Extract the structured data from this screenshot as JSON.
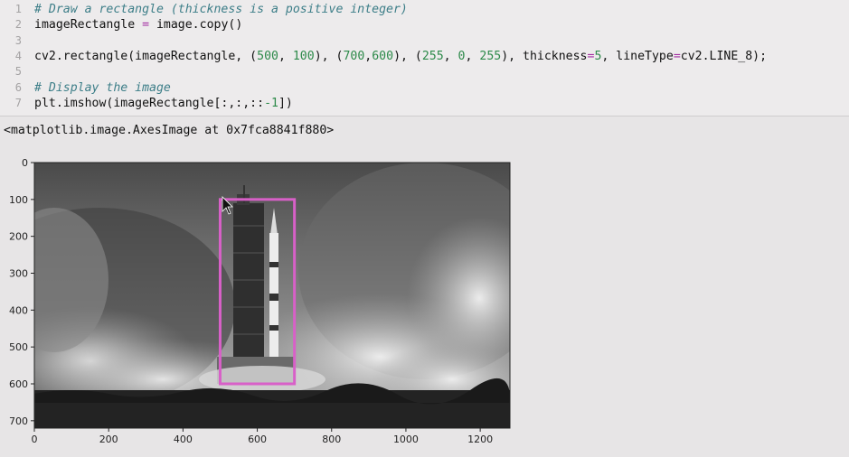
{
  "code_cell": {
    "lines": [
      {
        "n": "1",
        "parts": [
          {
            "t": "# Draw a rectangle (thickness is a positive integer)",
            "c": "cm"
          }
        ]
      },
      {
        "n": "2",
        "parts": [
          {
            "t": "imageRectangle ",
            "c": ""
          },
          {
            "t": "=",
            "c": "op"
          },
          {
            "t": " image.copy()",
            "c": ""
          }
        ]
      },
      {
        "n": "3",
        "parts": []
      },
      {
        "n": "4",
        "parts": [
          {
            "t": "cv2.rectangle(imageRectangle, (",
            "c": ""
          },
          {
            "t": "500",
            "c": "num"
          },
          {
            "t": ", ",
            "c": ""
          },
          {
            "t": "100",
            "c": "num"
          },
          {
            "t": "), (",
            "c": ""
          },
          {
            "t": "700",
            "c": "num"
          },
          {
            "t": ",",
            "c": ""
          },
          {
            "t": "600",
            "c": "num"
          },
          {
            "t": "), (",
            "c": ""
          },
          {
            "t": "255",
            "c": "num"
          },
          {
            "t": ", ",
            "c": ""
          },
          {
            "t": "0",
            "c": "num"
          },
          {
            "t": ", ",
            "c": ""
          },
          {
            "t": "255",
            "c": "num"
          },
          {
            "t": "), thickness",
            "c": ""
          },
          {
            "t": "=",
            "c": "op"
          },
          {
            "t": "5",
            "c": "num"
          },
          {
            "t": ", lineType",
            "c": ""
          },
          {
            "t": "=",
            "c": "op"
          },
          {
            "t": "cv2.LINE_8);",
            "c": ""
          }
        ]
      },
      {
        "n": "5",
        "parts": []
      },
      {
        "n": "6",
        "parts": [
          {
            "t": "# Display the image",
            "c": "cm"
          }
        ]
      },
      {
        "n": "7",
        "parts": [
          {
            "t": "plt.imshow(imageRectangle[:,:,::",
            "c": ""
          },
          {
            "t": "-1",
            "c": "num"
          },
          {
            "t": "])",
            "c": ""
          }
        ]
      }
    ]
  },
  "output": {
    "text": "<matplotlib.image.AxesImage at 0x7fca8841f880>"
  },
  "plot": {
    "x_ticks": [
      "0",
      "200",
      "400",
      "600",
      "800",
      "1000",
      "1200"
    ],
    "y_ticks": [
      "0",
      "100",
      "200",
      "300",
      "400",
      "500",
      "600",
      "700"
    ],
    "xlim": [
      0,
      1280
    ],
    "ylim": [
      720,
      0
    ],
    "rectangle": {
      "x1": 500,
      "y1": 100,
      "x2": 700,
      "y2": 600,
      "color": "#d860c8"
    }
  }
}
